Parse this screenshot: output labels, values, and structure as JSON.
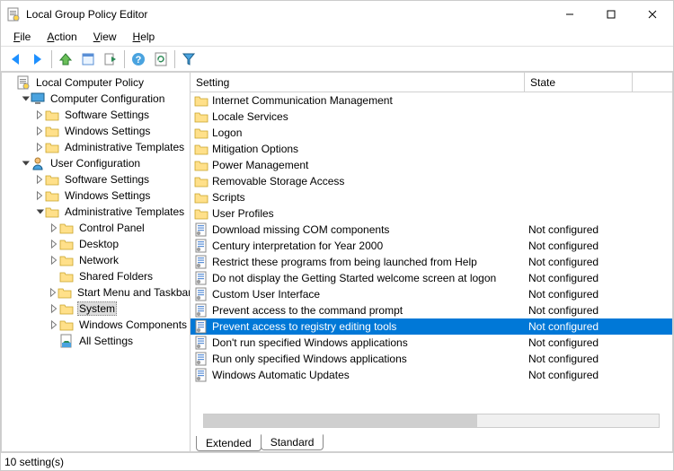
{
  "window": {
    "title": "Local Group Policy Editor"
  },
  "menubar": [
    "File",
    "Action",
    "View",
    "Help"
  ],
  "tree": [
    {
      "indent": 0,
      "exp": "",
      "icon": "policy",
      "label": "Local Computer Policy"
    },
    {
      "indent": 1,
      "exp": "open",
      "icon": "computer",
      "label": "Computer Configuration"
    },
    {
      "indent": 2,
      "exp": "closed",
      "icon": "folder",
      "label": "Software Settings"
    },
    {
      "indent": 2,
      "exp": "closed",
      "icon": "folder",
      "label": "Windows Settings"
    },
    {
      "indent": 2,
      "exp": "closed",
      "icon": "folder",
      "label": "Administrative Templates"
    },
    {
      "indent": 1,
      "exp": "open",
      "icon": "user",
      "label": "User Configuration"
    },
    {
      "indent": 2,
      "exp": "closed",
      "icon": "folder",
      "label": "Software Settings"
    },
    {
      "indent": 2,
      "exp": "closed",
      "icon": "folder",
      "label": "Windows Settings"
    },
    {
      "indent": 2,
      "exp": "open",
      "icon": "folder",
      "label": "Administrative Templates"
    },
    {
      "indent": 3,
      "exp": "closed",
      "icon": "folder",
      "label": "Control Panel"
    },
    {
      "indent": 3,
      "exp": "closed",
      "icon": "folder",
      "label": "Desktop"
    },
    {
      "indent": 3,
      "exp": "closed",
      "icon": "folder",
      "label": "Network"
    },
    {
      "indent": 3,
      "exp": "",
      "icon": "folder",
      "label": "Shared Folders"
    },
    {
      "indent": 3,
      "exp": "closed",
      "icon": "folder",
      "label": "Start Menu and Taskbar"
    },
    {
      "indent": 3,
      "exp": "closed",
      "icon": "folder",
      "label": "System",
      "selected": true
    },
    {
      "indent": 3,
      "exp": "closed",
      "icon": "folder",
      "label": "Windows Components"
    },
    {
      "indent": 3,
      "exp": "",
      "icon": "allsettings",
      "label": "All Settings"
    }
  ],
  "columns": {
    "setting": "Setting",
    "state": "State"
  },
  "settings": [
    {
      "icon": "folder",
      "name": "Internet Communication Management",
      "state": ""
    },
    {
      "icon": "folder",
      "name": "Locale Services",
      "state": ""
    },
    {
      "icon": "folder",
      "name": "Logon",
      "state": ""
    },
    {
      "icon": "folder",
      "name": "Mitigation Options",
      "state": ""
    },
    {
      "icon": "folder",
      "name": "Power Management",
      "state": ""
    },
    {
      "icon": "folder",
      "name": "Removable Storage Access",
      "state": ""
    },
    {
      "icon": "folder",
      "name": "Scripts",
      "state": ""
    },
    {
      "icon": "folder",
      "name": "User Profiles",
      "state": ""
    },
    {
      "icon": "setting",
      "name": "Download missing COM components",
      "state": "Not configured"
    },
    {
      "icon": "setting",
      "name": "Century interpretation for Year 2000",
      "state": "Not configured"
    },
    {
      "icon": "setting",
      "name": "Restrict these programs from being launched from Help",
      "state": "Not configured"
    },
    {
      "icon": "setting",
      "name": "Do not display the Getting Started welcome screen at logon",
      "state": "Not configured"
    },
    {
      "icon": "setting",
      "name": "Custom User Interface",
      "state": "Not configured"
    },
    {
      "icon": "setting",
      "name": "Prevent access to the command prompt",
      "state": "Not configured"
    },
    {
      "icon": "setting",
      "name": "Prevent access to registry editing tools",
      "state": "Not configured",
      "selected": true
    },
    {
      "icon": "setting",
      "name": "Don't run specified Windows applications",
      "state": "Not configured"
    },
    {
      "icon": "setting",
      "name": "Run only specified Windows applications",
      "state": "Not configured"
    },
    {
      "icon": "setting",
      "name": "Windows Automatic Updates",
      "state": "Not configured"
    }
  ],
  "tabs": [
    "Extended",
    "Standard"
  ],
  "active_tab": "Standard",
  "statusbar": "10 setting(s)"
}
